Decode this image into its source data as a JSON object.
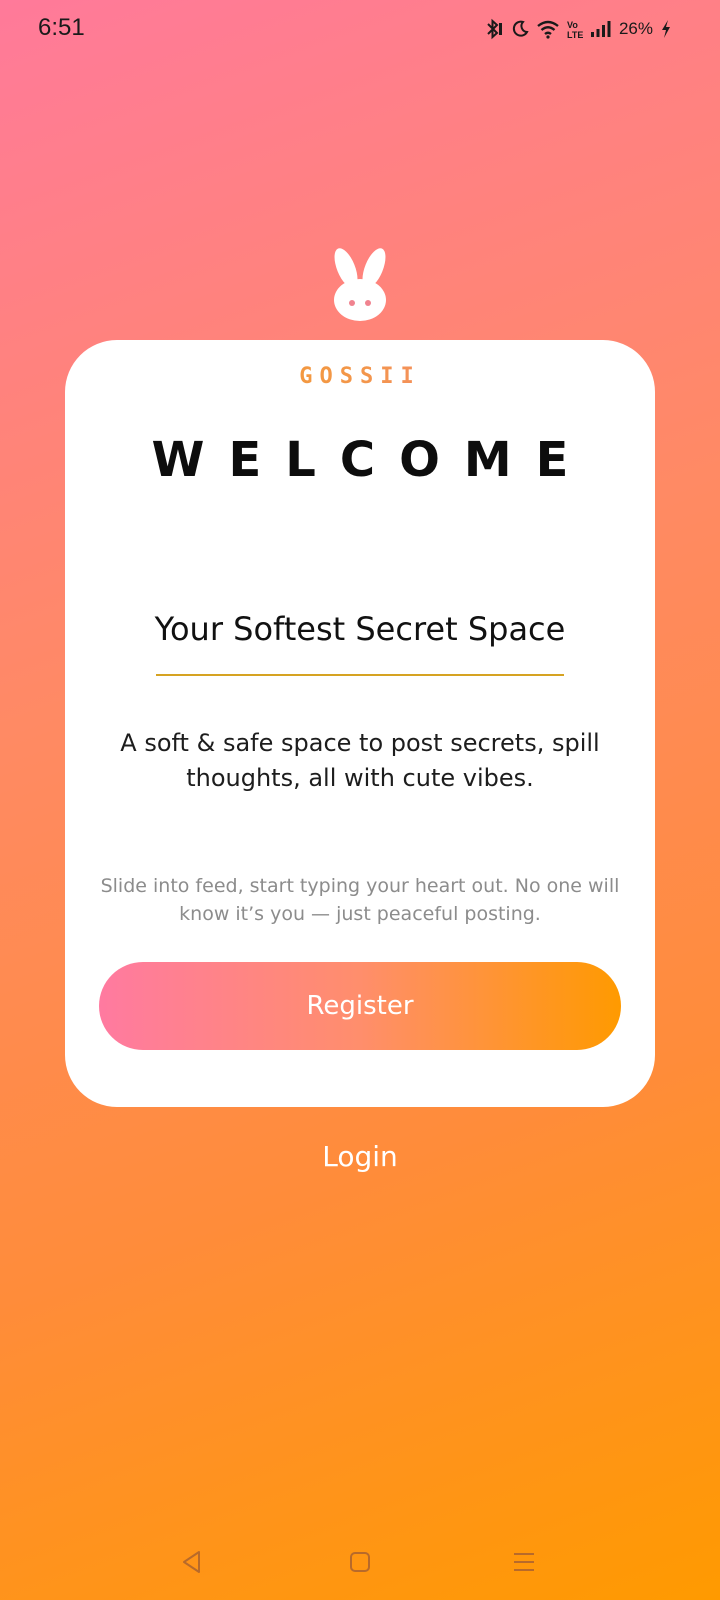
{
  "status_bar": {
    "time": "6:51",
    "battery": "26%",
    "icons": [
      "bluetooth-icon",
      "moon-icon",
      "wifi-icon",
      "volte-icon",
      "signal-icon",
      "charging-icon"
    ]
  },
  "mascot": {
    "icon": "bunny-icon"
  },
  "card": {
    "brand": "GOSSII",
    "title": "WELCOME",
    "subtitle": "Your Softest Secret Space",
    "tagline": "A soft & safe space to post secrets, spill thoughts, all with cute vibes.",
    "hint": "Slide into feed, start typing your heart out. No one will know it’s you — just peaceful posting.",
    "register_label": "Register"
  },
  "login_label": "Login",
  "nav": {
    "back": "back-icon",
    "home": "home-icon",
    "menu": "menu-icon"
  },
  "colors": {
    "gradient_top": "#ff7a9a",
    "gradient_bottom": "#ff9a00",
    "rule": "#d6a322",
    "button_start": "#ff7aa0",
    "button_end": "#ff9a00"
  }
}
